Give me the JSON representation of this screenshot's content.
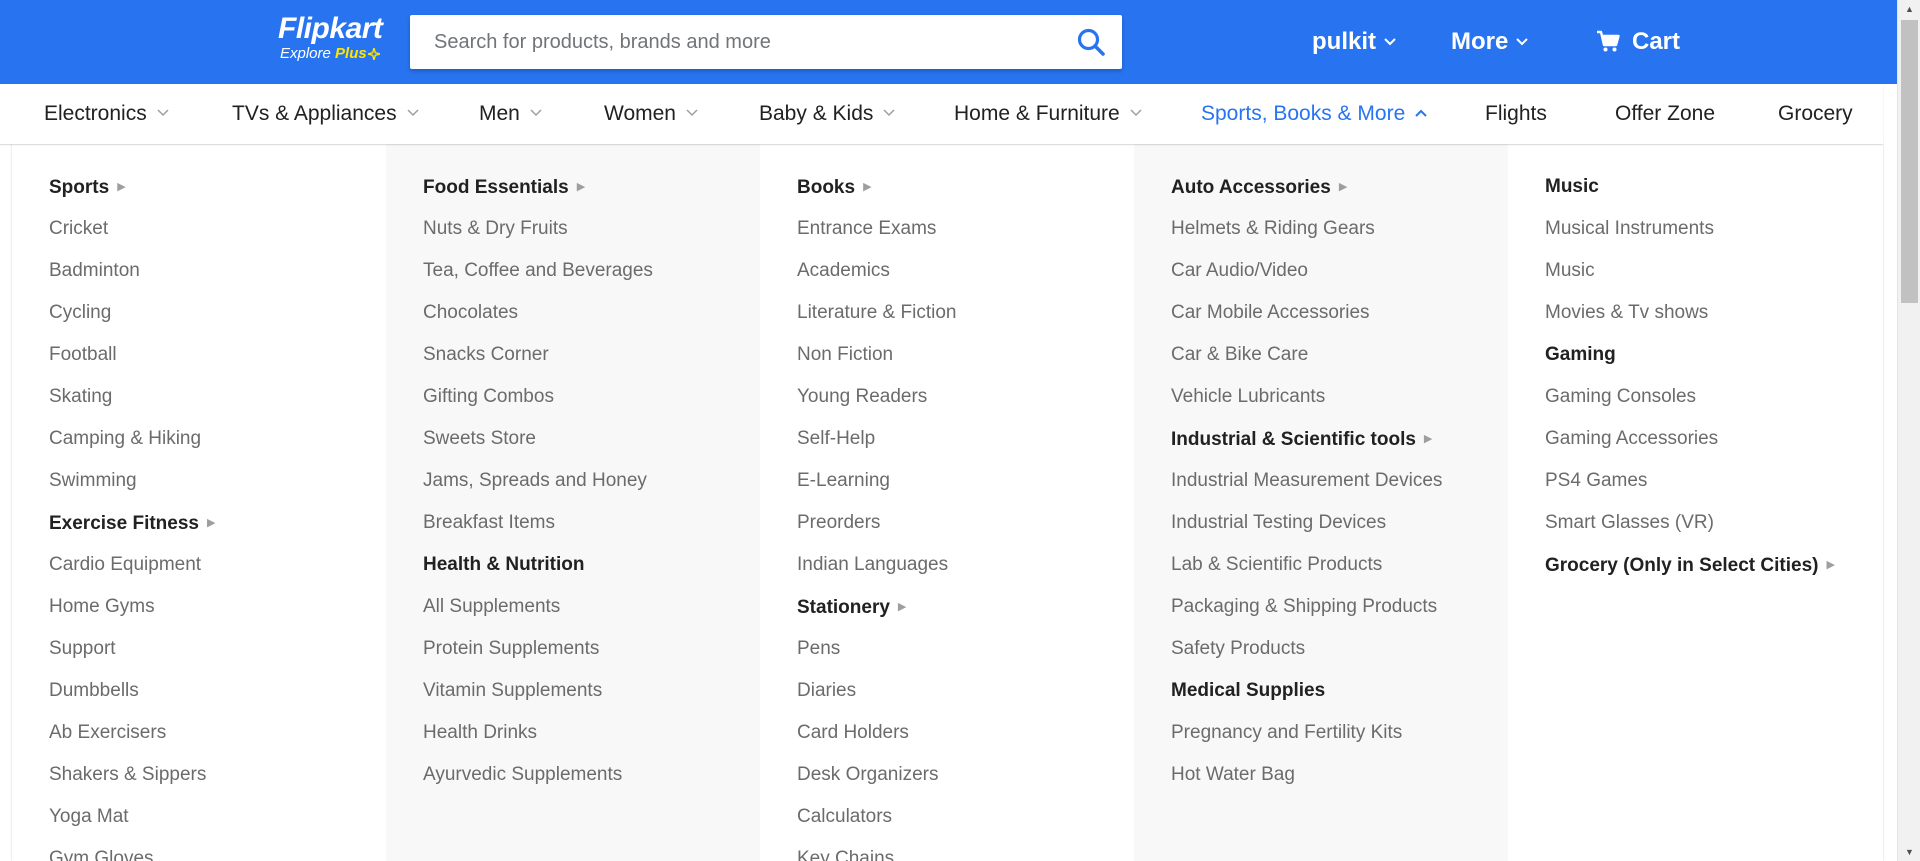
{
  "colors": {
    "brand_blue": "#2874f0",
    "plus_yellow": "#ffe500",
    "text_dark": "#212121",
    "text_muted": "#6b6b6b",
    "column_shade": "#f8f8f8"
  },
  "header": {
    "logo_main": "Flipkart",
    "logo_sub_prefix": "Explore",
    "logo_sub_plus": "Plus",
    "search_placeholder": "Search for products, brands and more",
    "search_icon": "search-icon",
    "user_label": "pulkit",
    "more_label": "More",
    "cart_label": "Cart",
    "cart_icon": "cart-icon"
  },
  "catnav": {
    "items": [
      {
        "label": "Electronics",
        "has_dropdown": true
      },
      {
        "label": "TVs & Appliances",
        "has_dropdown": true
      },
      {
        "label": "Men",
        "has_dropdown": true
      },
      {
        "label": "Women",
        "has_dropdown": true
      },
      {
        "label": "Baby & Kids",
        "has_dropdown": true
      },
      {
        "label": "Home & Furniture",
        "has_dropdown": true
      },
      {
        "label": "Sports, Books & More",
        "has_dropdown": true,
        "active": true
      },
      {
        "label": "Flights",
        "has_dropdown": false
      },
      {
        "label": "Offer Zone",
        "has_dropdown": false
      },
      {
        "label": "Grocery",
        "has_dropdown": false
      }
    ]
  },
  "menu": {
    "columns": [
      {
        "groups": [
          {
            "title": "Sports",
            "arrow": true,
            "items": [
              "Cricket",
              "Badminton",
              "Cycling",
              "Football",
              "Skating",
              "Camping & Hiking",
              "Swimming"
            ]
          },
          {
            "title": "Exercise Fitness",
            "arrow": true,
            "items": [
              "Cardio Equipment",
              "Home Gyms",
              "Support",
              "Dumbbells",
              "Ab Exercisers",
              "Shakers & Sippers",
              "Yoga Mat",
              "Gym Gloves"
            ]
          }
        ]
      },
      {
        "groups": [
          {
            "title": "Food Essentials",
            "arrow": true,
            "items": [
              "Nuts & Dry Fruits",
              "Tea, Coffee and Beverages",
              "Chocolates",
              "Snacks Corner",
              "Gifting Combos",
              "Sweets Store",
              "Jams, Spreads and Honey",
              "Breakfast Items"
            ]
          },
          {
            "title": "Health & Nutrition",
            "arrow": false,
            "items": [
              "All Supplements",
              "Protein Supplements",
              "Vitamin Supplements",
              "Health Drinks",
              "Ayurvedic Supplements"
            ]
          }
        ]
      },
      {
        "groups": [
          {
            "title": "Books",
            "arrow": true,
            "items": [
              "Entrance Exams",
              "Academics",
              "Literature & Fiction",
              "Non Fiction",
              "Young Readers",
              "Self-Help",
              "E-Learning",
              "Preorders",
              "Indian Languages"
            ]
          },
          {
            "title": "Stationery",
            "arrow": true,
            "items": [
              "Pens",
              "Diaries",
              "Card Holders",
              "Desk Organizers",
              "Calculators",
              "Key Chains"
            ]
          }
        ]
      },
      {
        "groups": [
          {
            "title": "Auto Accessories",
            "arrow": true,
            "items": [
              "Helmets & Riding Gears",
              "Car Audio/Video",
              "Car Mobile Accessories",
              "Car & Bike Care",
              "Vehicle Lubricants"
            ]
          },
          {
            "title": "Industrial & Scientific tools",
            "arrow": true,
            "items": [
              "Industrial Measurement Devices",
              "Industrial Testing Devices",
              "Lab & Scientific Products",
              "Packaging & Shipping Products",
              "Safety Products"
            ]
          },
          {
            "title": "Medical Supplies",
            "arrow": false,
            "items": [
              "Pregnancy and Fertility Kits",
              "Hot Water Bag"
            ]
          }
        ]
      },
      {
        "groups": [
          {
            "title": "Music",
            "arrow": false,
            "items": [
              "Musical Instruments",
              "Music",
              "Movies & Tv shows"
            ]
          },
          {
            "title": "Gaming",
            "arrow": false,
            "items": [
              "Gaming Consoles",
              "Gaming Accessories",
              "PS4 Games",
              "Smart Glasses (VR)"
            ]
          },
          {
            "title": "Grocery (Only in Select Cities)",
            "arrow": true,
            "items": []
          }
        ]
      }
    ]
  }
}
